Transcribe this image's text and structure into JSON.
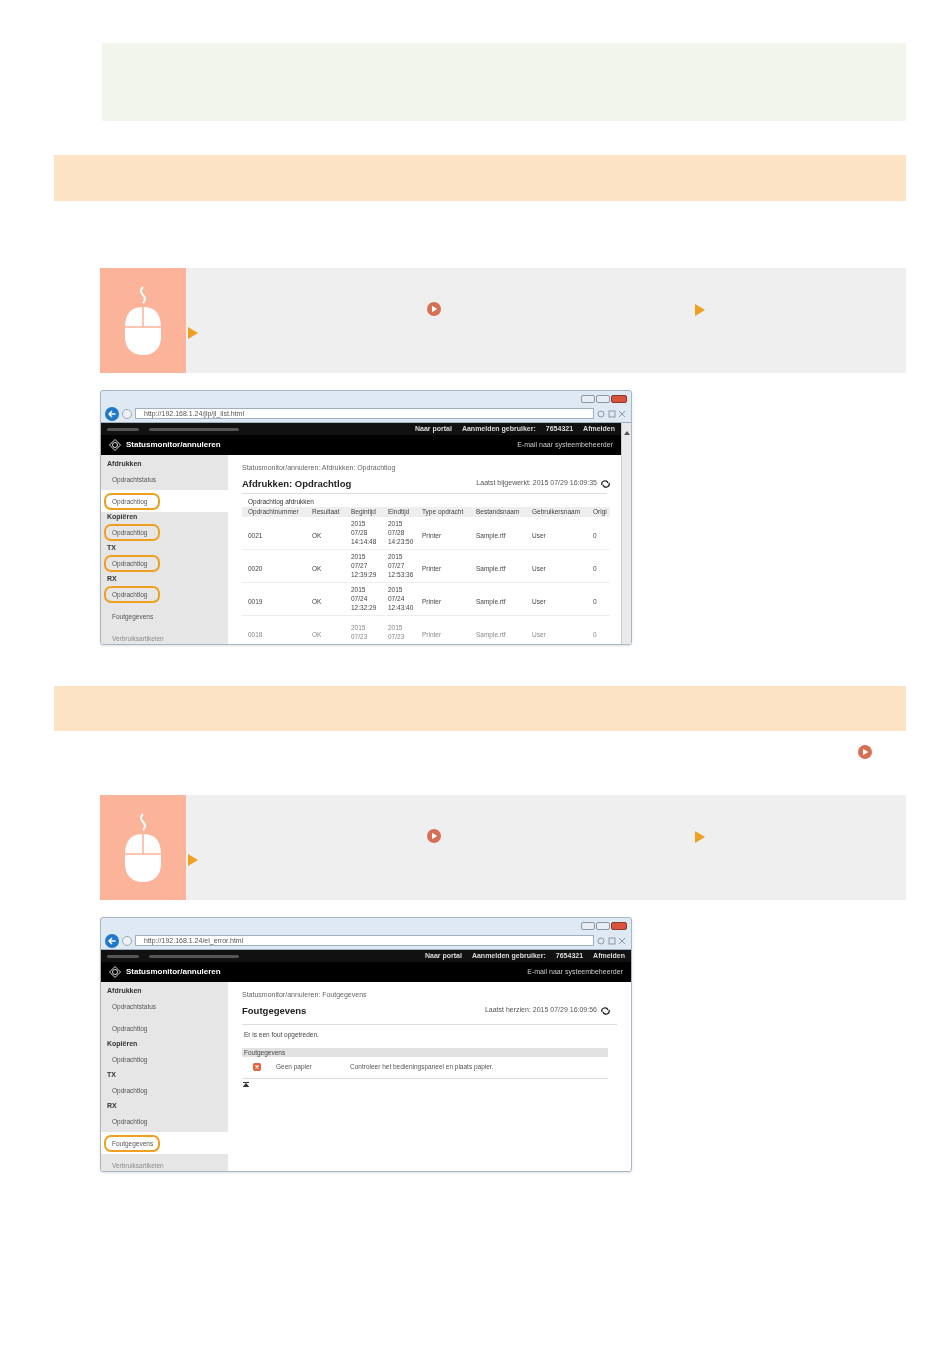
{
  "browser_windows": [
    {
      "kind": "job_log",
      "url": "http://192.168.1.24/jlp/jl_list.html",
      "top_links": [
        "Naar portal",
        "Aanmelden gebruiker:",
        "7654321",
        "Afmelden"
      ],
      "app_title": "Statusmonitor/annuleren",
      "email_link": "E-mail naar systeembeheerder",
      "sidebar": [
        {
          "heading": "Afdrukken",
          "items": [
            {
              "label": "Opdrachtstatus",
              "selected": false,
              "circled": false,
              "faded": false
            },
            {
              "label": "Opdrachtlog",
              "selected": true,
              "circled": true,
              "faded": false
            }
          ]
        },
        {
          "heading": "Kopiëren",
          "items": [
            {
              "label": "Opdrachtlog",
              "selected": false,
              "circled": true,
              "faded": false
            }
          ]
        },
        {
          "heading": "TX",
          "items": [
            {
              "label": "Opdrachtlog",
              "selected": false,
              "circled": true,
              "faded": false
            }
          ]
        },
        {
          "heading": "RX",
          "items": [
            {
              "label": "Opdrachtlog",
              "selected": false,
              "circled": true,
              "faded": false
            },
            {
              "label": "Foutgegevens",
              "selected": false,
              "circled": false,
              "faded": false
            },
            {
              "label": "Verbruiksartikelen",
              "selected": false,
              "circled": false,
              "faded": true
            }
          ]
        }
      ],
      "breadcrumb": "Statusmonitor/annuleren: Afdrukken: Opdrachtlog",
      "title": "Afdrukken: Opdrachtlog",
      "updated": "Laatst bijgewerkt: 2015 07/29 16:09:35",
      "section": "Opdrachtlog afdrukken",
      "table": {
        "columns": [
          "Opdrachtnummer",
          "Resultaat",
          "Begintijd",
          "Eindtijd",
          "Type opdracht",
          "Bestandsnaam",
          "Gebruikersnaam",
          "Origi"
        ],
        "rows": [
          {
            "faded": false,
            "cells": [
              "0021",
              "OK",
              "2015 07/28 14:14:48",
              "2015 07/28 14:23:50",
              "Printer",
              "Sample.rtf",
              "User",
              "0"
            ]
          },
          {
            "faded": false,
            "cells": [
              "0020",
              "OK",
              "2015 07/27 12:39:29",
              "2015 07/27 12:53:36",
              "Printer",
              "Sample.rtf",
              "User",
              "0"
            ]
          },
          {
            "faded": false,
            "cells": [
              "0019",
              "OK",
              "2015 07/24 12:32:29",
              "2015 07/24 12:43:40",
              "Printer",
              "Sample.rtf",
              "User",
              "0"
            ]
          },
          {
            "faded": true,
            "cells": [
              "0018",
              "OK",
              "2015 07/23",
              "2015 07/23",
              "Printer",
              "Sample.rtf",
              "User",
              "0"
            ]
          }
        ]
      }
    },
    {
      "kind": "error_info",
      "url": "http://192.168.1.24/el_error.html",
      "top_links": [
        "Naar portal",
        "Aanmelden gebruiker:",
        "7654321",
        "Afmelden"
      ],
      "app_title": "Statusmonitor/annuleren",
      "email_link": "E-mail naar systeembeheerder",
      "sidebar": [
        {
          "heading": "Afdrukken",
          "items": [
            {
              "label": "Opdrachtstatus",
              "selected": false,
              "circled": false,
              "faded": false
            },
            {
              "label": "Opdrachtlog",
              "selected": false,
              "circled": false,
              "faded": false
            }
          ]
        },
        {
          "heading": "Kopiëren",
          "items": [
            {
              "label": "Opdrachtlog",
              "selected": false,
              "circled": false,
              "faded": false
            }
          ]
        },
        {
          "heading": "TX",
          "items": [
            {
              "label": "Opdrachtlog",
              "selected": false,
              "circled": false,
              "faded": false
            }
          ]
        },
        {
          "heading": "RX",
          "items": [
            {
              "label": "Opdrachtlog",
              "selected": false,
              "circled": false,
              "faded": false
            },
            {
              "label": "Foutgegevens",
              "selected": true,
              "circled": true,
              "faded": false
            },
            {
              "label": "Verbruiksartikelen",
              "selected": false,
              "circled": false,
              "faded": true
            }
          ]
        }
      ],
      "breadcrumb": "Statusmonitor/annuleren: Foutgegevens",
      "title": "Foutgegevens",
      "updated": "Laatst herzien: 2015 07/29 16:09:56",
      "message": "Er is een fout opgetreden.",
      "section": "Foutgegevens",
      "errors": [
        {
          "name": "Geen papier",
          "action": "Controleer het bedieningspaneel en plaats papier."
        }
      ]
    }
  ]
}
